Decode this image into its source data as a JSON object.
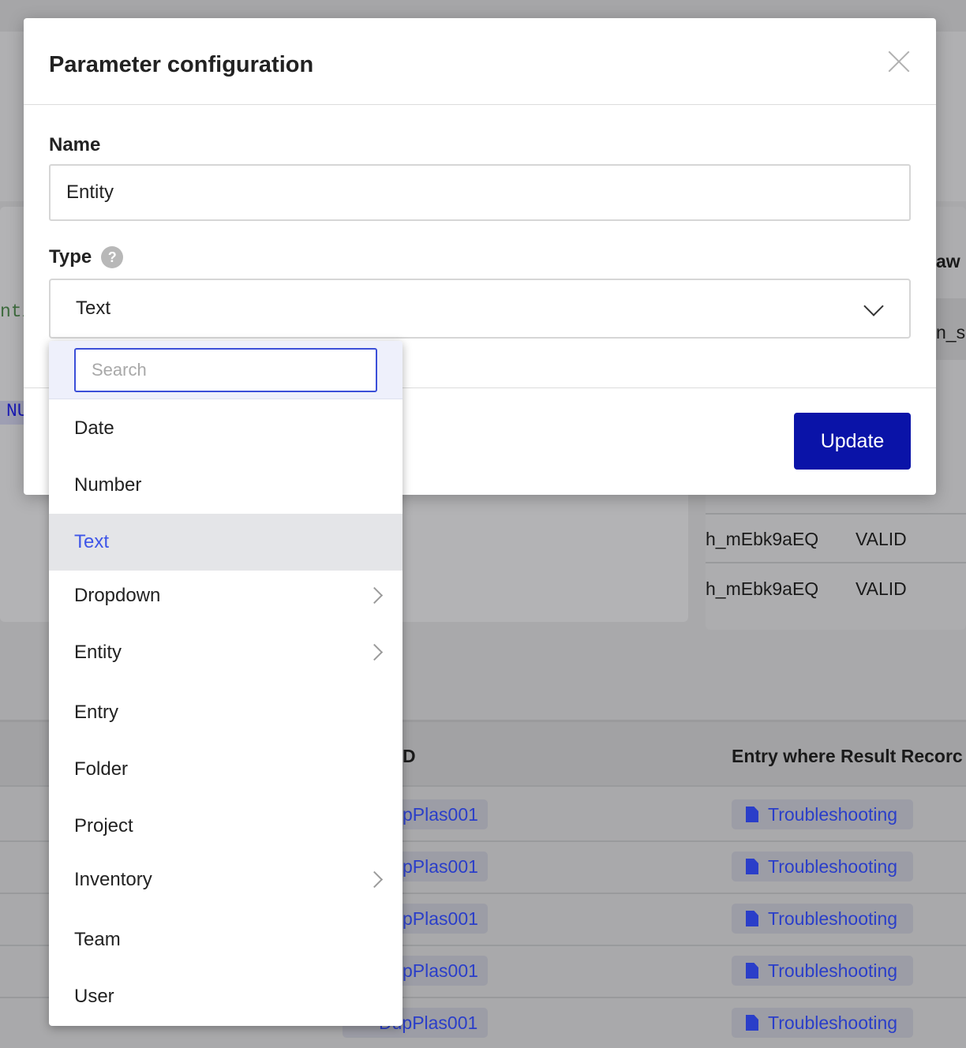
{
  "modal": {
    "title": "Parameter configuration",
    "name_label": "Name",
    "name_value": "Entity",
    "type_label": "Type",
    "help_glyph": "?",
    "type_value": "Text",
    "update_label": "Update"
  },
  "dropdown": {
    "search_placeholder": "Search",
    "selected": "Text",
    "options": [
      {
        "label": "Date",
        "has_submenu": false
      },
      {
        "label": "Number",
        "has_submenu": false
      },
      {
        "label": "Text",
        "has_submenu": false
      },
      {
        "label": "Dropdown",
        "has_submenu": true
      },
      {
        "label": "Entity",
        "has_submenu": true
      },
      {
        "label": "Entry",
        "has_submenu": false
      },
      {
        "label": "Folder",
        "has_submenu": false
      },
      {
        "label": "Project",
        "has_submenu": false
      },
      {
        "label": "Inventory",
        "has_submenu": true
      },
      {
        "label": "Team",
        "has_submenu": false
      },
      {
        "label": "User",
        "has_submenu": false
      }
    ]
  },
  "background": {
    "code_fragment": "nti",
    "null_fragment": "NU",
    "raw_header_fragment": "aw",
    "cell_fragment": "n_s",
    "table_rows": [
      {
        "id": "h_mEbk9aEQ",
        "status": "VALID"
      },
      {
        "id": "h_mEbk9aEQ",
        "status": "VALID"
      }
    ],
    "id_header_fragment": "D",
    "entry_header": "Entry where Result Recorc",
    "result_rows": [
      {
        "sample": "pPlas001",
        "entry": "Troubleshooting"
      },
      {
        "sample": "pPlas001",
        "entry": "Troubleshooting"
      },
      {
        "sample": "pPlas001",
        "entry": "Troubleshooting"
      },
      {
        "sample": "pPlas001",
        "entry": "Troubleshooting"
      },
      {
        "sample": "DupPlas001",
        "entry": "Troubleshooting"
      }
    ]
  }
}
